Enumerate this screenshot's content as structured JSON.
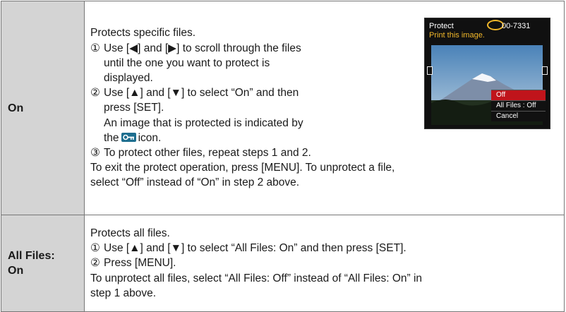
{
  "rows": [
    {
      "key": "On",
      "lines": [
        "Protects specific files.",
        "①",
        "Use [◀] and [▶] to scroll through the files",
        "until the one you want to protect is",
        "displayed.",
        "②",
        "Use [▲] and [▼] to select “On” and then",
        "press [SET].",
        "An image that is protected is indicated by",
        "the",
        "icon.",
        "③",
        "To protect other files, repeat steps 1 and 2.",
        "To exit the protect operation, press [MENU]. To unprotect a file,",
        "select “Off” instead of “On” in step 2 above."
      ]
    },
    {
      "key_line1": "All Files:",
      "key_line2": "On",
      "lines": [
        "Protects all files.",
        "①",
        "Use [▲] and [▼] to select “All Files: On” and then press [SET].",
        "②",
        "Press [MENU].",
        "To unprotect all files, select “All Files: Off” instead of “All Files: On” in",
        "step 1 above."
      ]
    }
  ],
  "screen": {
    "title": "Protect",
    "file_no": "00-7331",
    "print_hint": "Print this image.",
    "menu": [
      "Off",
      "All Files : Off",
      "Cancel"
    ],
    "selected_menu": "Off",
    "highlight_color": "#c0141b",
    "accent_color": "#f2b82a"
  }
}
